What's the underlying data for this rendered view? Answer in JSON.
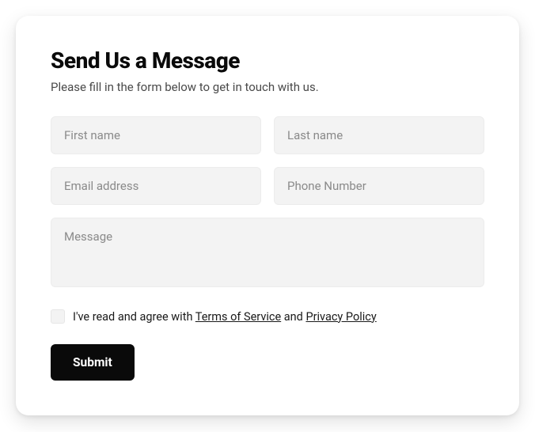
{
  "form": {
    "title": "Send Us a Message",
    "subtitle": "Please fill in the form below to get in touch with us.",
    "fields": {
      "first_name": {
        "placeholder": "First name",
        "value": ""
      },
      "last_name": {
        "placeholder": "Last name",
        "value": ""
      },
      "email": {
        "placeholder": "Email address",
        "value": ""
      },
      "phone": {
        "placeholder": "Phone Number",
        "value": ""
      },
      "message": {
        "placeholder": "Message",
        "value": ""
      }
    },
    "consent": {
      "checked": false,
      "prefix": "I've read and agree with ",
      "terms_label": "Terms of Service",
      "mid": " and ",
      "privacy_label": "Privacy Policy"
    },
    "submit_label": "Submit"
  }
}
